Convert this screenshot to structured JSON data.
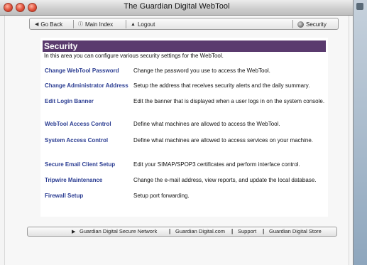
{
  "window": {
    "title": "The Guardian Digital WebTool",
    "backdrop_color": "#9fb4c8"
  },
  "nav": {
    "go_back": {
      "icon": "arrow-left-icon",
      "glyph": "◀",
      "label": "Go Back"
    },
    "main_index": {
      "icon": "index-circle-icon",
      "glyph": "ⓘ",
      "label": "Main Index"
    },
    "logout": {
      "icon": "arrow-up-icon",
      "glyph": "▲",
      "label": "Logout"
    },
    "current": {
      "icon": "gear-icon",
      "label": "Security"
    }
  },
  "page": {
    "heading": "Security",
    "heading_color": "#5a3a6e",
    "intro": "In this area you can configure various security settings for the WebTool.",
    "link_color": "#2b3d92",
    "items": [
      {
        "label": "Change WebTool Password",
        "description": "Change the password you use to access the WebTool."
      },
      {
        "label": "Change Administrator Address",
        "description": "Setup the address that receives security alerts and the daily summary."
      },
      {
        "label": "Edit Login Banner",
        "description": "Edit the banner that is displayed when a user logs in on the system console."
      },
      {
        "label": "WebTool Access Control",
        "description": "Define what machines are allowed to access the WebTool."
      },
      {
        "label": "System Access Control",
        "description": "Define what machines are allowed to access services on your machine."
      },
      {
        "label": "Secure Email Client Setup",
        "description": "Edit your SIMAP/SPOP3 certificates and perform interface control."
      },
      {
        "label": "Tripwire Maintenance",
        "description": "Change the e-mail address, view reports, and update the local database."
      },
      {
        "label": "Firewall Setup",
        "description": "Setup port forwarding."
      }
    ]
  },
  "footer": {
    "icon": "arrow-right-icon",
    "glyph": "▶",
    "links": [
      "Guardian Digital Secure Network",
      "Guardian Digital.com",
      "Support",
      "Guardian Digital Store"
    ],
    "separator": "|"
  }
}
